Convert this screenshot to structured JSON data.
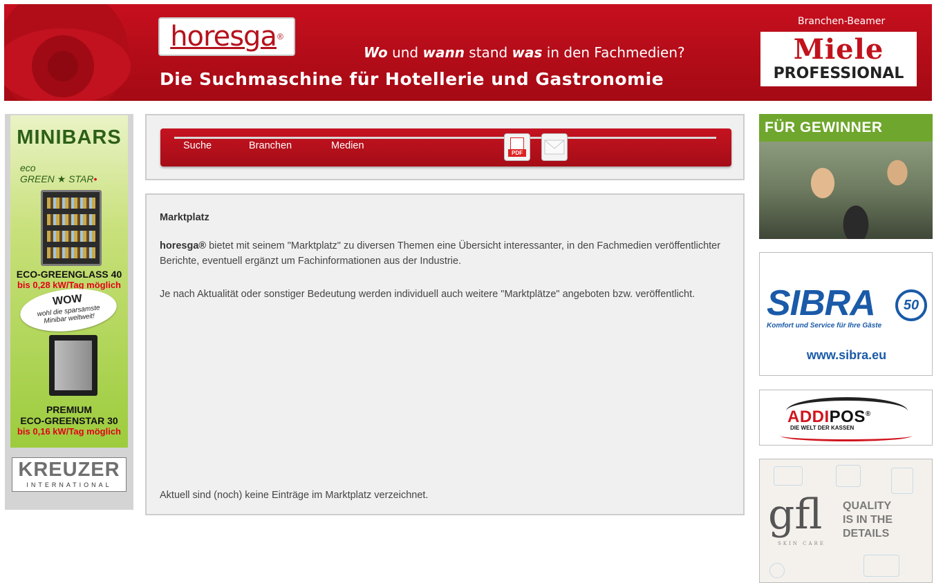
{
  "header": {
    "logo": "horesga",
    "logo_reg": "®",
    "tagline_wo": "Wo",
    "tagline_und": " und ",
    "tagline_wann": "wann",
    "tagline_stand": " stand ",
    "tagline_was": "was",
    "tagline_end": " in den Fachmedien?",
    "title": "Die Suchmaschine für Hotellerie und Gastronomie",
    "beamer_label": "Branchen-Beamer",
    "miele_name": "Miele",
    "miele_sub": "PROFESSIONAL"
  },
  "nav": {
    "items": [
      {
        "label": "Suche"
      },
      {
        "label": "Branchen"
      },
      {
        "label": "Medien"
      }
    ],
    "pdf_tag": "PDF"
  },
  "content": {
    "heading": "Marktplatz",
    "p1_brand": "horesga®",
    "p1_text": " bietet mit seinem \"Marktplatz\" zu diversen Themen eine Übersicht interessanter, in den Fachmedien veröffentlichter Berichte, eventuell ergänzt um Fachinformationen aus der Industrie.",
    "p2": "Je nach Aktualität oder sonstiger Bedeutung werden individuell auch weitere \"Marktplätze\" angeboten bzw. veröffentlicht.",
    "footer": "Aktuell sind (noch) keine Einträge im Marktplatz verzeichnet."
  },
  "left_ad": {
    "title": "MINIBARS",
    "eco_small": "eco",
    "eco_green": "GREEN",
    "eco_star": "STAR",
    "model1": "ECO-GREENGLASS 40",
    "model1_sub": "bis 0,28 kW/Tag möglich",
    "wow_big": "WOW",
    "wow_small1": "wohl die sparsamste",
    "wow_small2": "Minibar weltweit!",
    "model2_line1": "PREMIUM",
    "model2_line2": "ECO-GREENSTAR 30",
    "model2_sub": "bis 0,16 kW/Tag möglich",
    "brand": "KREUZER",
    "brand_sub": "INTERNATIONAL"
  },
  "right_ads": {
    "gewinner": "FÜR GEWINNER",
    "sibra_name": "SIBRA",
    "sibra_50": "50",
    "sibra_sub": "Komfort und Service für Ihre Gäste",
    "sibra_url": "www.sibra.eu",
    "addipos_red": "ADDI",
    "addipos_black": "POS",
    "addipos_reg": "®",
    "addipos_sub": "DIE WELT DER KASSEN",
    "gfl_logo": "gfl",
    "gfl_sub": "SKIN CARE",
    "gfl_q1": "QUALITY",
    "gfl_q2": "IS IN THE",
    "gfl_q3": "DETAILS"
  }
}
